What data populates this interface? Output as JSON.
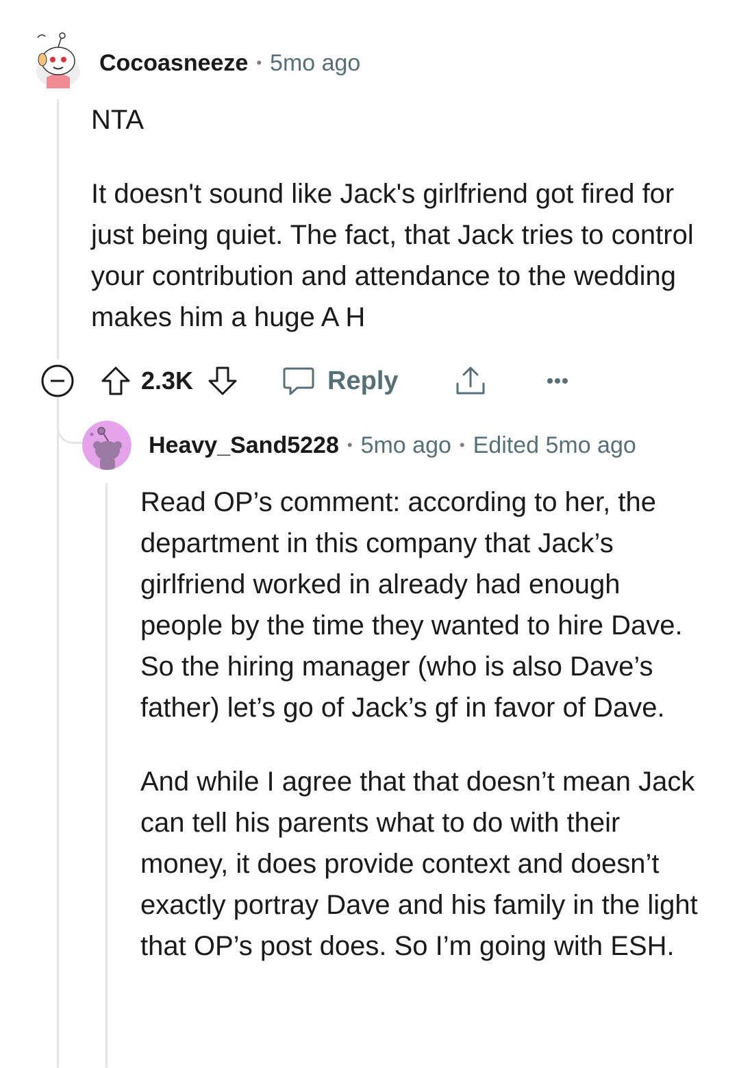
{
  "comment": {
    "username": "Cocoasneeze",
    "time": "5mo ago",
    "body": [
      "NTA",
      "It doesn't sound like Jack's girlfriend got fired for just being quiet. The fact, that Jack tries to control your contribution and attendance to the wedding makes him a huge A H"
    ],
    "votes": "2.3K",
    "reply_label": "Reply"
  },
  "reply": {
    "username": "Heavy_Sand5228",
    "time": "5mo ago",
    "edited": "Edited 5mo ago",
    "body": [
      "Read OP’s comment: according to her, the department in this company that Jack’s girlfriend worked in already had enough people by the time they wanted to hire Dave. So the hiring manager (who is also Dave’s father) let’s go of Jack’s gf in favor of Dave.",
      "And while I agree that that doesn’t mean Jack can tell his parents what to do with their money, it does provide context and doesn’t exactly portray Dave and his family in the light that OP’s post does. So I’m going with ESH."
    ],
    "avatar_color": "#e5a3ec"
  },
  "colors": {
    "thread_line": "#e5e5e5",
    "meta": "#576f76",
    "text": "#1a1a1b"
  }
}
